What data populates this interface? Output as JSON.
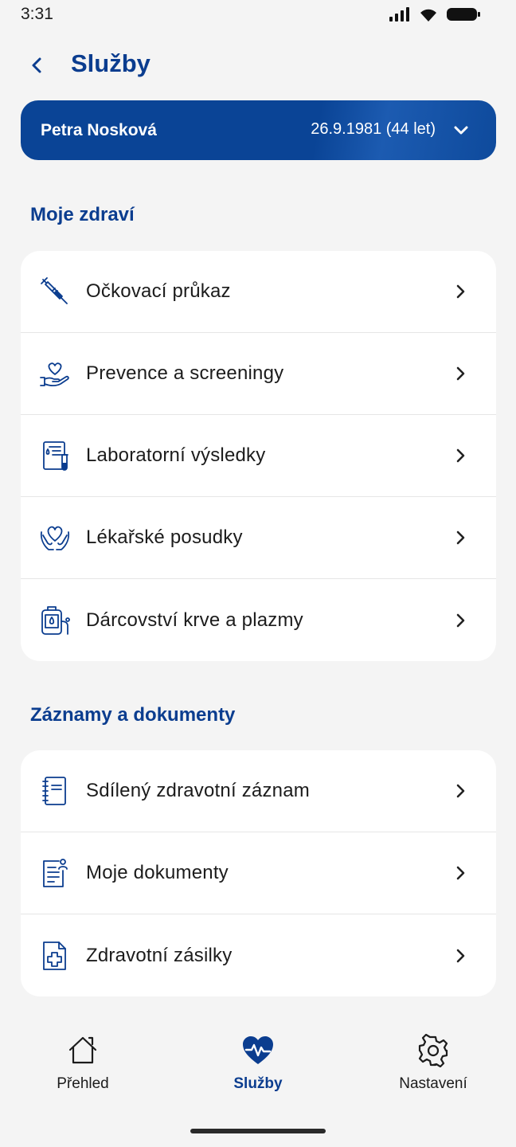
{
  "status_bar": {
    "time": "3:31"
  },
  "header": {
    "title": "Služby"
  },
  "patient": {
    "name": "Petra Nosková",
    "dob": "26.9.1981 (44 let)"
  },
  "sections": [
    {
      "title": "Moje zdraví",
      "items": [
        {
          "label": "Očkovací průkaz",
          "icon": "syringe-icon"
        },
        {
          "label": "Prevence a screeningy",
          "icon": "heart-hand-icon"
        },
        {
          "label": "Laboratorní výsledky",
          "icon": "lab-report-icon"
        },
        {
          "label": "Lékařské posudky",
          "icon": "heart-hands-icon"
        },
        {
          "label": "Dárcovství krve a plazmy",
          "icon": "blood-bag-icon"
        }
      ]
    },
    {
      "title": "Záznamy a dokumenty",
      "items": [
        {
          "label": "Sdílený zdravotní záznam",
          "icon": "notebook-icon"
        },
        {
          "label": "Moje dokumenty",
          "icon": "person-document-icon"
        },
        {
          "label": "Zdravotní zásilky",
          "icon": "medical-document-icon"
        }
      ]
    }
  ],
  "bottom_nav": [
    {
      "label": "Přehled",
      "icon": "home-icon",
      "active": false
    },
    {
      "label": "Služby",
      "icon": "heart-pulse-icon",
      "active": true
    },
    {
      "label": "Nastavení",
      "icon": "gear-icon",
      "active": false
    }
  ],
  "colors": {
    "primary": "#0b3d8f",
    "card_gradient_start": "#0a4496",
    "icon_blue": "#0b3d8f",
    "background": "#f4f4f4"
  }
}
